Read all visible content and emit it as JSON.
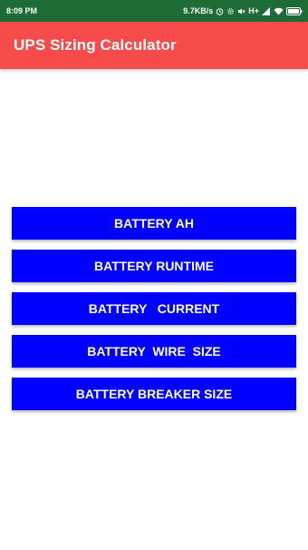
{
  "status_bar": {
    "time": "8:09 PM",
    "network_speed": "9.7KB/s",
    "network_type": "H+",
    "icons": [
      "alarm-clock-icon",
      "settings-gear-icon",
      "mute-icon",
      "signal-icon",
      "wifi-icon",
      "battery-icon"
    ],
    "background_color": "#1d6b35"
  },
  "app_bar": {
    "title": "UPS Sizing Calculator",
    "background_color": "#f74a4a"
  },
  "menu": {
    "button_color": "#0000ff",
    "buttons": [
      {
        "label": "BATTERY AH"
      },
      {
        "label": "BATTERY RUNTIME"
      },
      {
        "label": "BATTERY   CURRENT"
      },
      {
        "label": "BATTERY  WIRE  SIZE"
      },
      {
        "label": "BATTERY BREAKER SIZE"
      }
    ]
  }
}
